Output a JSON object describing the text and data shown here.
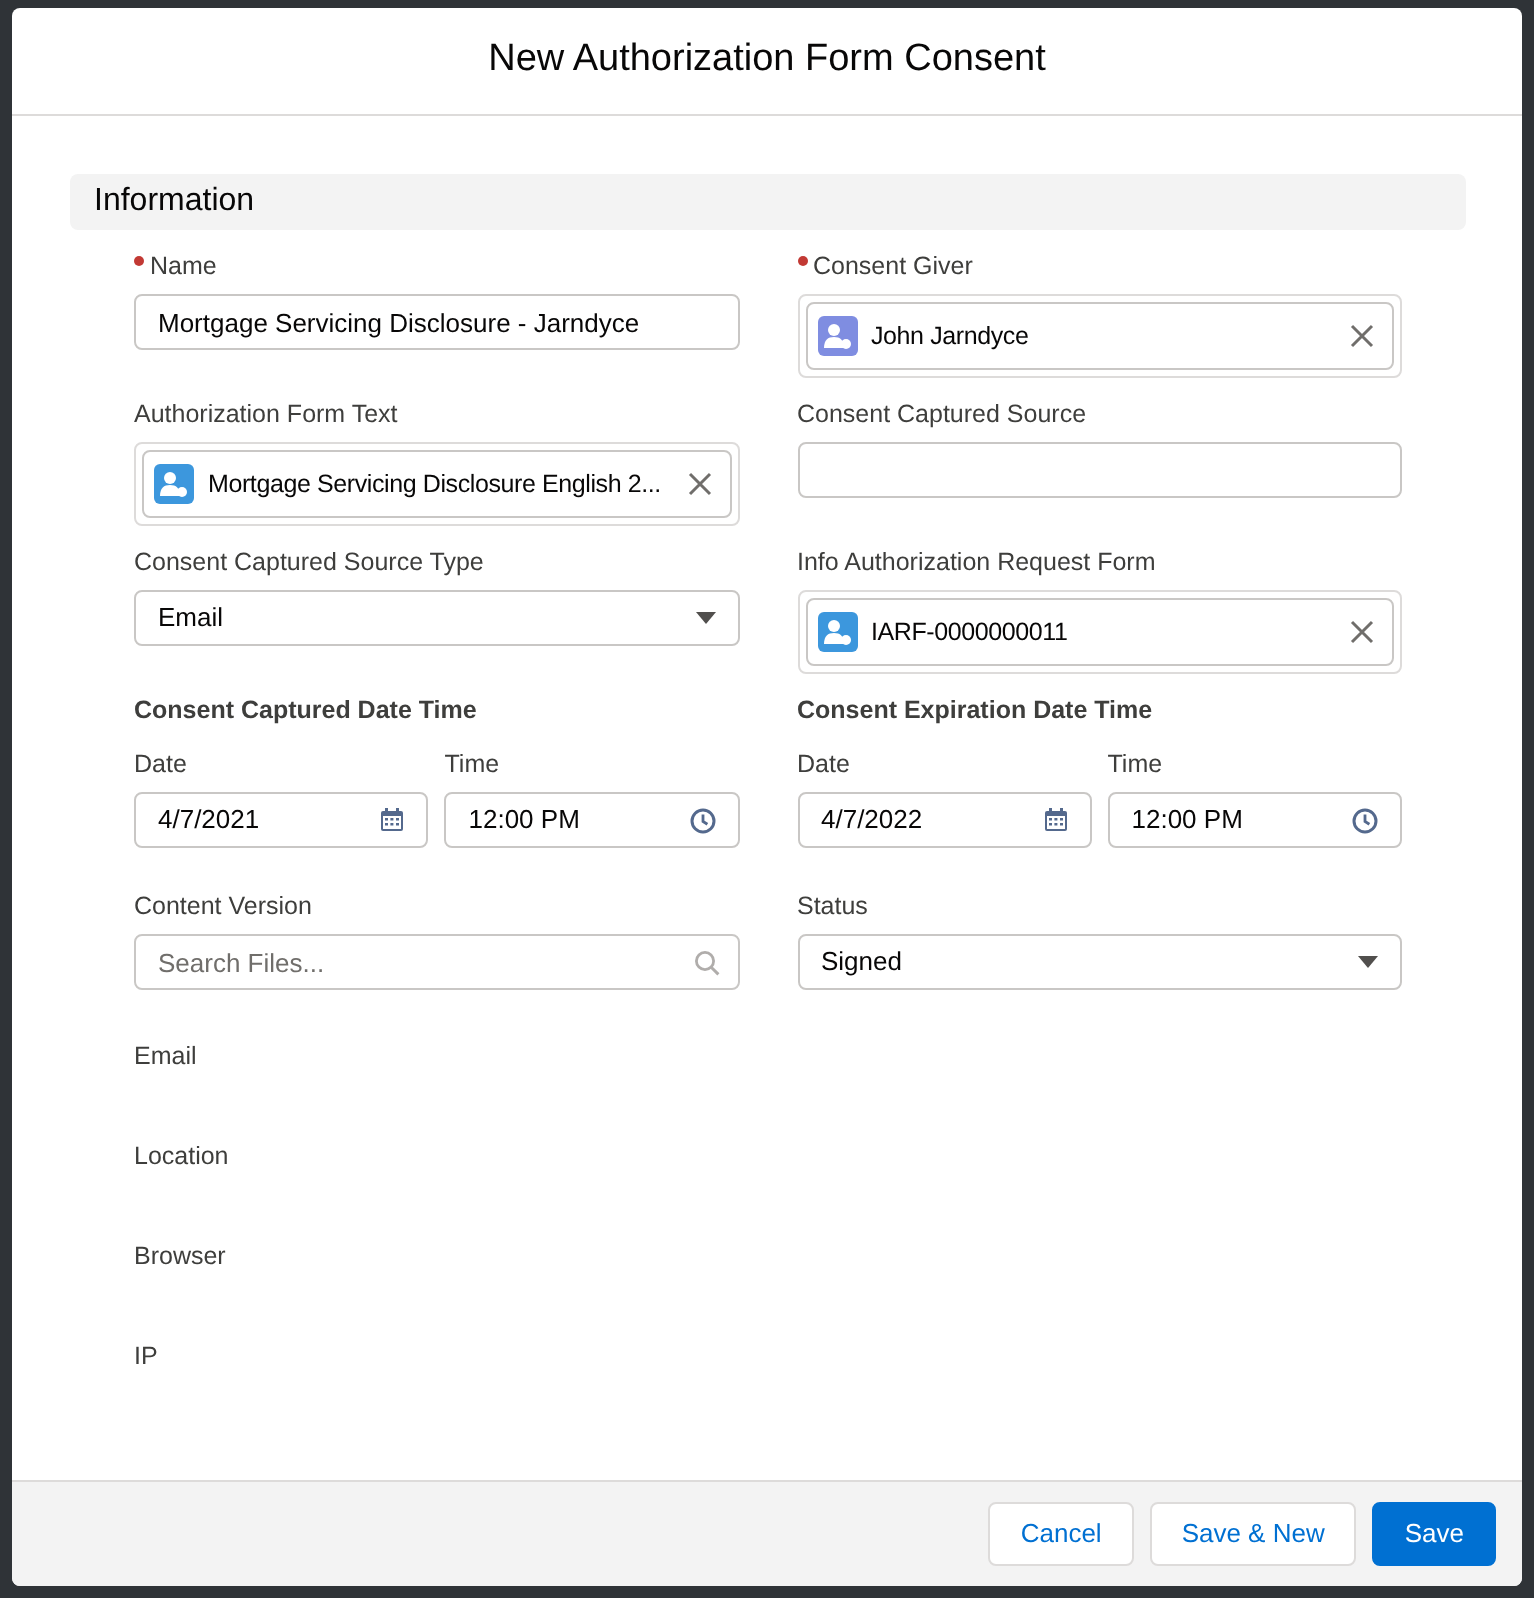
{
  "modal": {
    "title": "New Authorization Form Consent"
  },
  "section": {
    "title": "Information"
  },
  "fields": [
    {
      "kind": "text",
      "label": "Name",
      "required": true,
      "value": "Mortgage Servicing Disclosure - Jarndyce"
    },
    {
      "kind": "lookup",
      "label": "Consent Giver",
      "required": true,
      "value": "John Jarndyce",
      "color": "#7f8de1"
    },
    {
      "kind": "lookup",
      "label": "Authorization Form Text",
      "value": "Mortgage Servicing Disclosure English 2...",
      "color": "#3c97dd"
    },
    {
      "kind": "text",
      "label": "Consent Captured Source"
    },
    {
      "kind": "picklist",
      "label": "Consent Captured Source Type",
      "value": "Email"
    },
    {
      "kind": "lookup",
      "label": "Info Authorization Request Form",
      "value": "IARF-0000000011",
      "color": "#3c97dd"
    },
    {
      "kind": "datetime",
      "label": "Consent Captured Date Time",
      "date_label": "Date",
      "date": "4/7/2021",
      "time_label": "Time",
      "time": "12:00 PM"
    },
    {
      "kind": "datetime",
      "label": "Consent Expiration Date Time",
      "date_label": "Date",
      "date": "4/7/2022",
      "time_label": "Time",
      "time": "12:00 PM"
    },
    {
      "kind": "search",
      "label": "Content Version",
      "placeholder": "Search Files..."
    },
    {
      "kind": "picklist",
      "label": "Status",
      "value": "Signed"
    }
  ],
  "readonly_fields": [
    {
      "label": "Email"
    },
    {
      "label": "Location"
    },
    {
      "label": "Browser"
    },
    {
      "label": "IP"
    }
  ],
  "footer_buttons": [
    {
      "label": "Cancel",
      "kind": "neutral"
    },
    {
      "label": "Save & New",
      "kind": "neutral"
    },
    {
      "label": "Save",
      "kind": "brand"
    }
  ]
}
